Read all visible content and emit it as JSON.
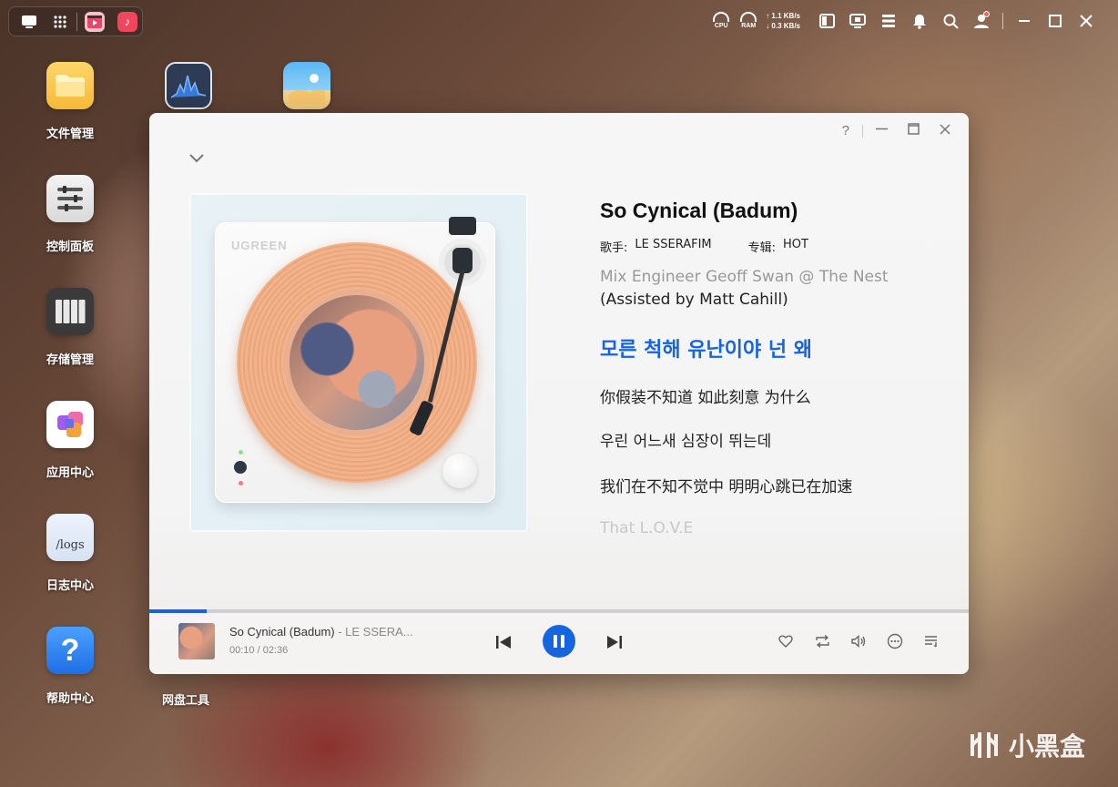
{
  "taskbar": {
    "network": {
      "up": "↑ 1.1 KB/s",
      "down": "↓ 0.3 KB/s"
    },
    "cpu_label": "CPU",
    "ram_label": "RAM",
    "right_icons": [
      "layout-icon",
      "monitor-icon",
      "sliders-icon",
      "bell-icon",
      "search-icon",
      "user-icon"
    ],
    "window_icons": [
      "minimize-icon",
      "maximize-icon",
      "close-icon"
    ]
  },
  "desktop": {
    "icons": [
      {
        "label": "文件管理",
        "icon": "folder-icon"
      },
      {
        "label": "控制面板",
        "icon": "control-panel-icon"
      },
      {
        "label": "存储管理",
        "icon": "storage-icon"
      },
      {
        "label": "应用中心",
        "icon": "app-center-icon"
      },
      {
        "label": "日志中心",
        "icon": "logs-icon",
        "glyph": "/logs"
      },
      {
        "label": "帮助中心",
        "icon": "help-icon",
        "glyph": "?"
      }
    ],
    "netdisk_label": "网盘工具",
    "watermark": "小黑盒"
  },
  "player": {
    "brand": "UGREEN",
    "song": {
      "title": "So Cynical (Badum)",
      "artist_key": "歌手:",
      "artist": "LE SSERAFIM",
      "album_key": "专辑:",
      "album": "HOT"
    },
    "lyrics": [
      {
        "text": "Mix Engineer Geoff Swan @ The Nest",
        "state": "fade1"
      },
      {
        "text": "(Assisted by Matt Cahill)",
        "state": "normal"
      },
      {
        "text": "모른 척해 유난이야 넌 왜",
        "state": "active"
      },
      {
        "text": "你假装不知道 如此刻意 为什么",
        "state": "normal"
      },
      {
        "text": "우린 어느새 심장이 뛰는데",
        "state": "normal"
      },
      {
        "text": "我们在不知不觉中 明明心跳已在加速",
        "state": "normal"
      },
      {
        "text": "That L.O.V.E",
        "state": "fade2"
      }
    ],
    "now_playing": {
      "title": "So Cynical (Badum)",
      "artist": " - LE SSERA...",
      "time": "00:10 / 02:36",
      "progress": 0.07
    },
    "accent_color": "#1565e0"
  }
}
